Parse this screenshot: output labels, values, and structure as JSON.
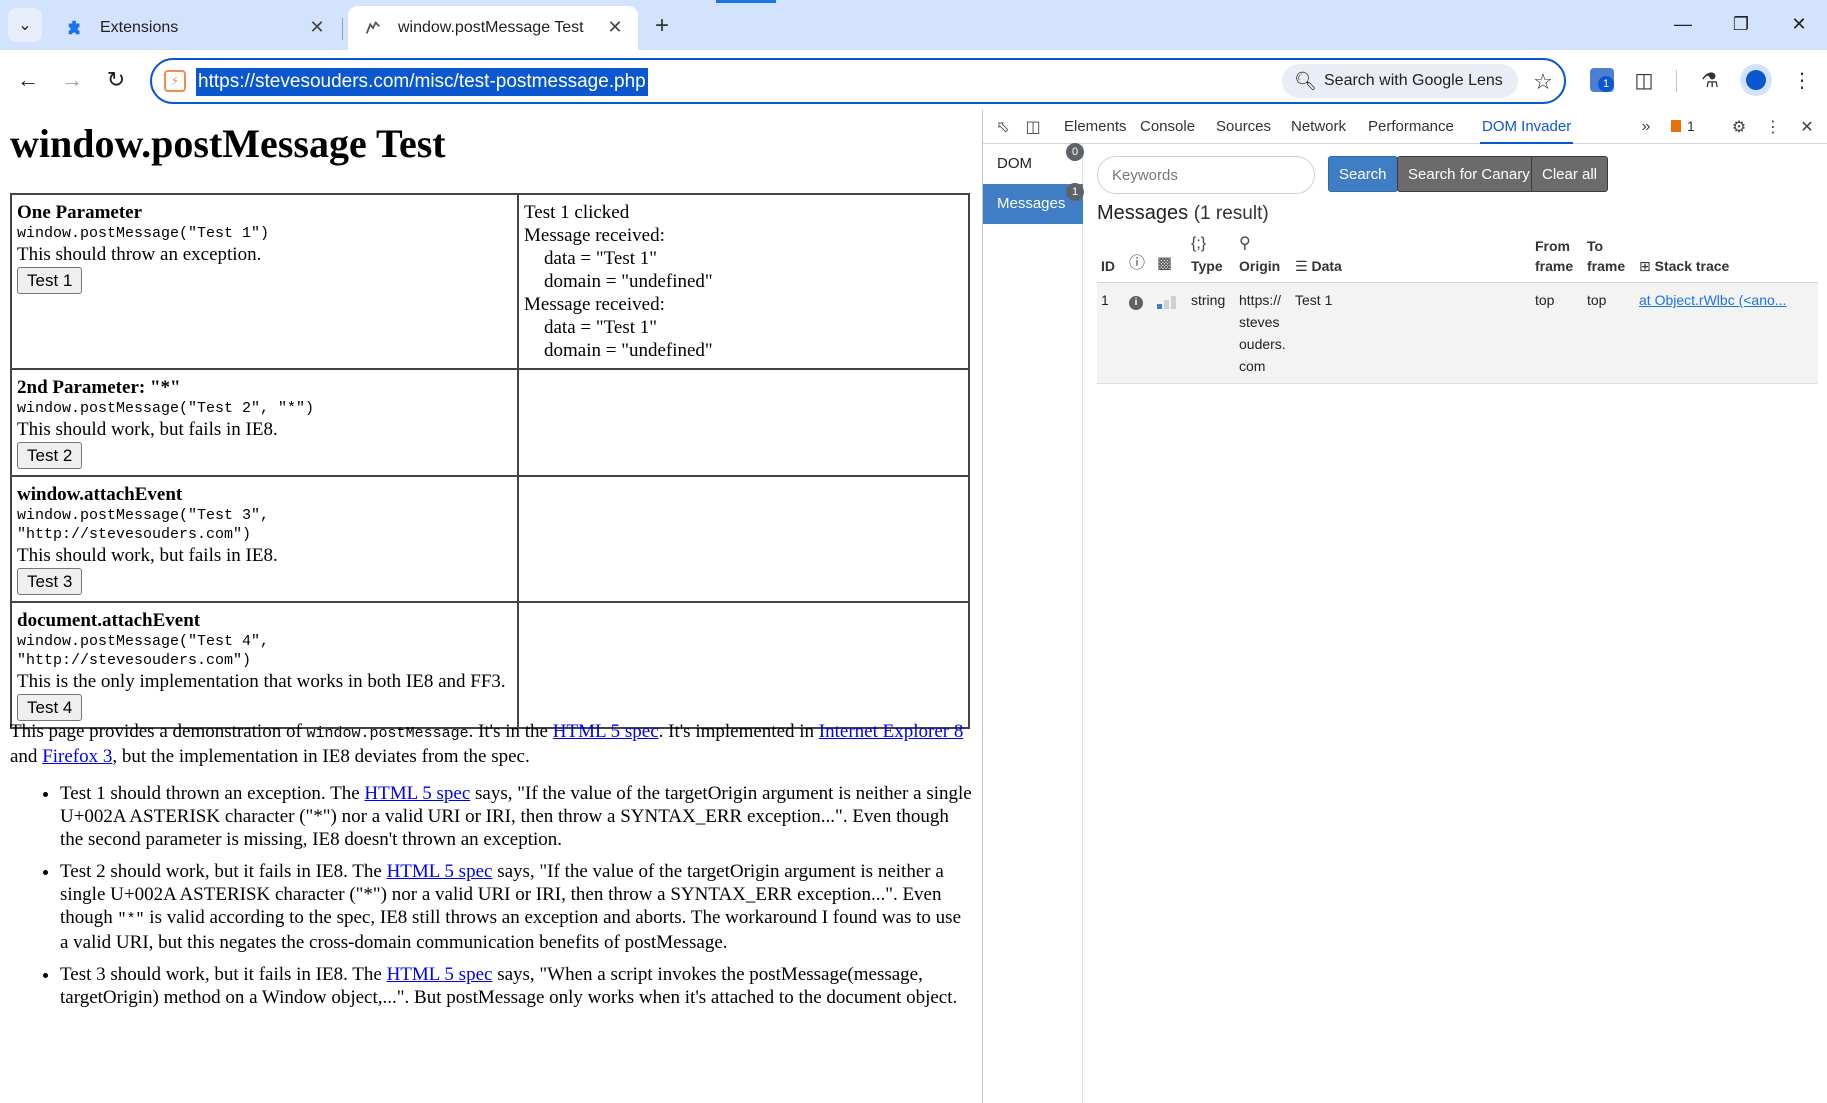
{
  "browser": {
    "tabs": [
      {
        "title": "Extensions",
        "icon": "puzzle-icon"
      },
      {
        "title": "window.postMessage Test",
        "icon": "site-favicon",
        "active": true
      }
    ],
    "url": "https://stevesouders.com/misc/test-postmessage.php",
    "lens_label": "Search with Google Lens",
    "extension_badge": "1"
  },
  "page": {
    "title": "window.postMessage Test",
    "tests": [
      {
        "heading": "One Parameter",
        "code": "window.postMessage(\"Test 1\")",
        "note": "This should throw an exception.",
        "button": "Test 1",
        "output_title": "Test 1 clicked",
        "messages": [
          {
            "label": "Message received:",
            "data": "data = \"Test 1\"",
            "domain": "domain = \"undefined\""
          },
          {
            "label": "Message received:",
            "data": "data = \"Test 1\"",
            "domain": "domain = \"undefined\""
          }
        ]
      },
      {
        "heading": "2nd Parameter: \"*\"",
        "code": "window.postMessage(\"Test 2\", \"*\")",
        "note": "This should work, but fails in IE8.",
        "button": "Test 2"
      },
      {
        "heading": "window.attachEvent",
        "code": "window.postMessage(\"Test 3\", \"http://stevesouders.com\")",
        "note": "This should work, but fails in IE8.",
        "button": "Test 3"
      },
      {
        "heading": "document.attachEvent",
        "code": "window.postMessage(\"Test 4\", \"http://stevesouders.com\")",
        "note": "This is the only implementation that works in both IE8 and FF3.",
        "button": "Test 4"
      }
    ],
    "intro": {
      "t1": "This page provides a demonstration of ",
      "code": "window.postMessage",
      "t2": ". It's in the ",
      "link_spec": "HTML 5 spec",
      "t3": ". It's implemented in ",
      "link_ie": "Internet Explorer 8",
      "t4": " and ",
      "link_ff": "Firefox 3",
      "t5": ", but the implementation in IE8 deviates from the spec."
    },
    "bullets": [
      {
        "before": "Test 1 should thrown an exception. The ",
        "link": "HTML 5 spec",
        "after": " says, \"If the value of the targetOrigin argument is neither a single U+002A ASTERISK character (\"*\") nor a valid URI or IRI, then throw a SYNTAX_ERR exception...\". Even though the second parameter is missing, IE8 doesn't thrown an exception."
      },
      {
        "before": "Test 2 should work, but it fails in IE8. The ",
        "link": "HTML 5 spec",
        "after": " says, \"If the value of the targetOrigin argument is neither a single U+002A ASTERISK character (\"*\") nor a valid URI or IRI, then throw a SYNTAX_ERR exception...\". Even though ",
        "code": "\"*\"",
        "after2": " is valid according to the spec, IE8 still throws an exception and aborts. The workaround I found was to use a valid URI, but this negates the cross-domain communication benefits of postMessage."
      },
      {
        "before": "Test 3 should work, but it fails in IE8. The ",
        "link": "HTML 5 spec",
        "after": " says, \"When a script invokes the postMessage(message, targetOrigin) method on a Window object,...\". But postMessage only works when it's attached to the document object."
      }
    ]
  },
  "devtools": {
    "tabs": [
      "Elements",
      "Console",
      "Sources",
      "Network",
      "Performance",
      "DOM Invader"
    ],
    "active_tab": "DOM Invader",
    "issues_count": "1",
    "sidebar": [
      {
        "label": "DOM",
        "count": "0"
      },
      {
        "label": "Messages",
        "count": "1",
        "active": true
      }
    ],
    "search_placeholder": "Keywords",
    "buttons": {
      "search": "Search",
      "canary": "Search for Canary",
      "clear": "Clear all"
    },
    "heading": "Messages",
    "result_count": "(1 result)",
    "columns": {
      "id": "ID",
      "type": "Type",
      "origin": "Origin",
      "data": "Data",
      "from": "From frame",
      "to": "To frame",
      "stack": "Stack trace"
    },
    "rows": [
      {
        "id": "1",
        "type": "string",
        "origin": "https://stevesouders.com",
        "data": "Test 1",
        "from": "top",
        "to": "top",
        "stack": "at Object.rWlbc (<ano..."
      }
    ],
    "accent_color": "#3f7ec4"
  }
}
